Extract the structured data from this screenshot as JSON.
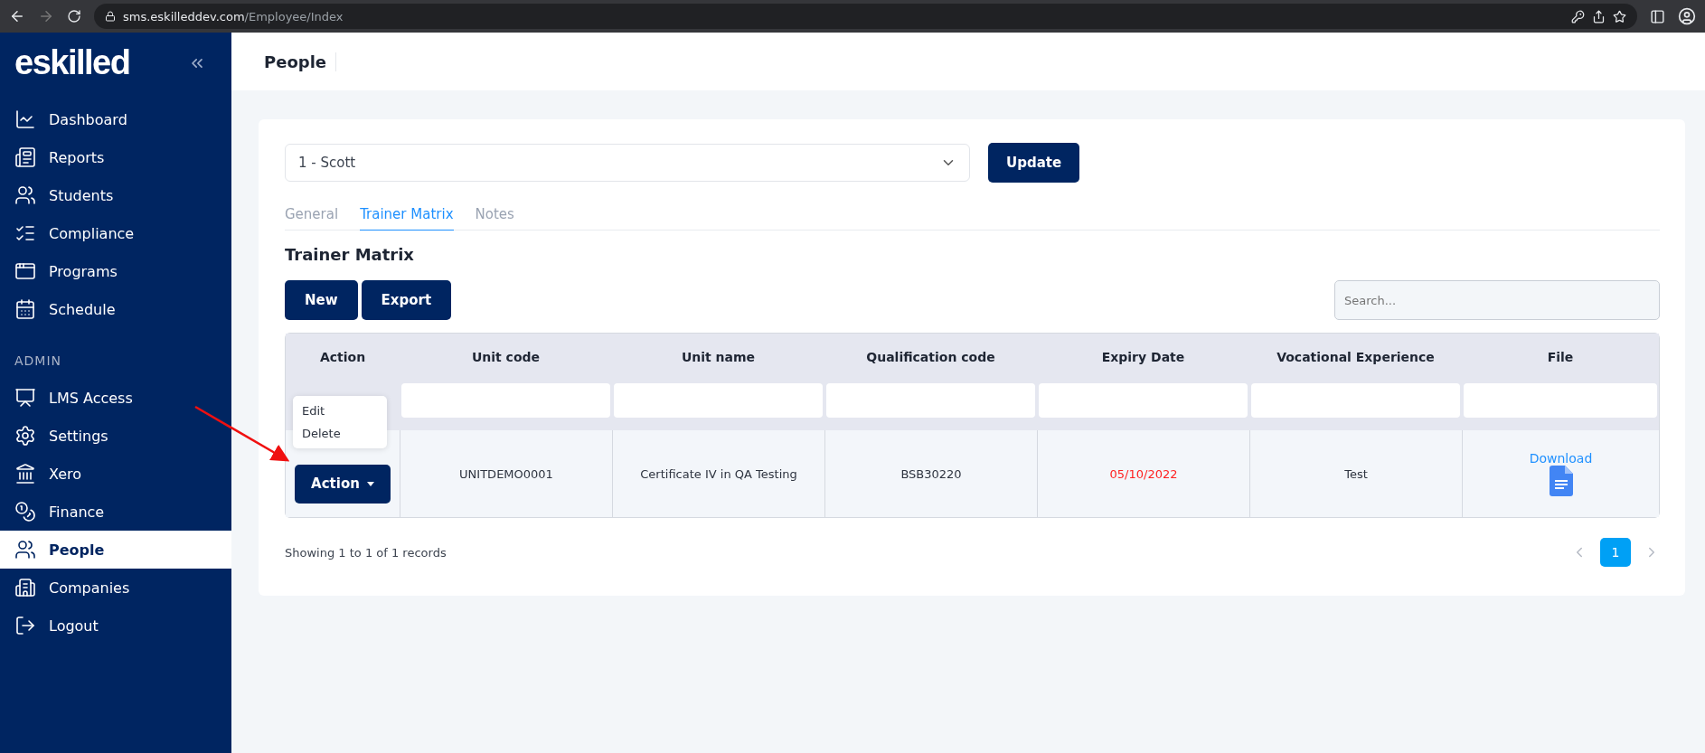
{
  "browser": {
    "url_host": "sms.eskilleddev.com",
    "url_path": "/Employee/Index"
  },
  "sidebar": {
    "logo": "eskilled",
    "items": [
      {
        "label": "Dashboard",
        "selected": false
      },
      {
        "label": "Reports",
        "selected": false
      },
      {
        "label": "Students",
        "selected": false
      },
      {
        "label": "Compliance",
        "selected": false
      },
      {
        "label": "Programs",
        "selected": false
      },
      {
        "label": "Schedule",
        "selected": false
      }
    ],
    "section_title": "ADMIN",
    "admin_items": [
      {
        "label": "LMS Access",
        "selected": false
      },
      {
        "label": "Settings",
        "selected": false
      },
      {
        "label": "Xero",
        "selected": false
      },
      {
        "label": "Finance",
        "selected": false
      },
      {
        "label": "People",
        "selected": true
      },
      {
        "label": "Companies",
        "selected": false
      },
      {
        "label": "Logout",
        "selected": false
      }
    ]
  },
  "page_title": "People",
  "person_select": {
    "value": "1 - Scott"
  },
  "update_button": "Update",
  "tabs": [
    {
      "label": "General",
      "selected": false
    },
    {
      "label": "Trainer Matrix",
      "selected": true
    },
    {
      "label": "Notes",
      "selected": false
    }
  ],
  "section_heading": "Trainer Matrix",
  "toolbar_buttons": [
    "New",
    "Export"
  ],
  "search": {
    "placeholder": "Search..."
  },
  "table": {
    "columns": [
      "Action",
      "Unit code",
      "Unit name",
      "Qualification code",
      "Expiry Date",
      "Vocational Experience",
      "File"
    ],
    "rows": [
      {
        "action": "Action",
        "unit_code": "UNITDEMO0001",
        "unit_name": "Certificate IV in QA Testing",
        "qualification_code": "BSB30220",
        "expiry_date": "05/10/2022",
        "expired": true,
        "vocational_experience": "Test",
        "file_link": "Download"
      }
    ]
  },
  "action_menu": {
    "open": true,
    "items": [
      "Edit",
      "Delete"
    ]
  },
  "footer": {
    "summary": "Showing 1 to 1 of 1 records",
    "pages": [
      {
        "label": "1",
        "selected": true
      }
    ]
  }
}
